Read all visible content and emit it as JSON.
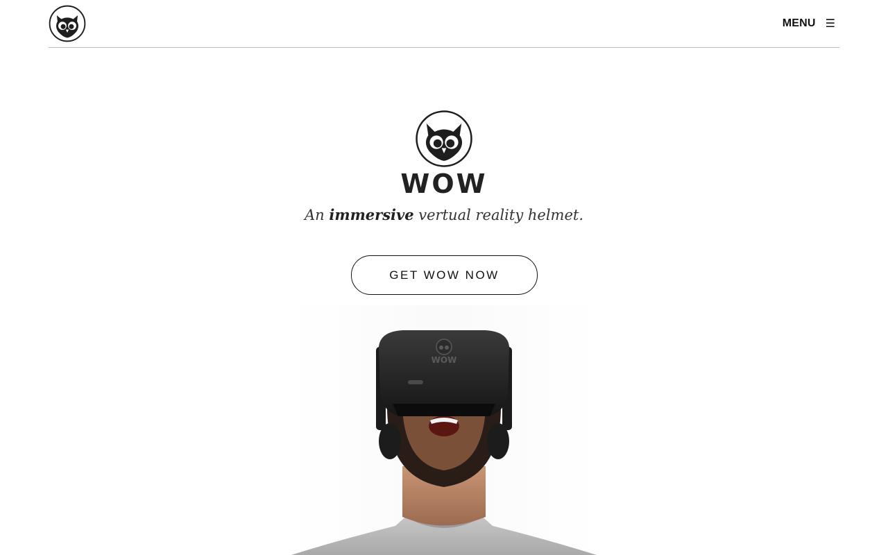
{
  "header": {
    "logo_icon": "owl-logo-icon",
    "menu_label": "MENU",
    "menu_icon": "hamburger-menu-icon",
    "menu_glyph": "☰"
  },
  "hero": {
    "logo_icon": "owl-logo-icon",
    "brand": "WOW",
    "tagline_prefix": "An ",
    "tagline_emphasis": "immersive",
    "tagline_suffix": " vertual reality helmet.",
    "cta_label": "GET WOW NOW",
    "image_subject": "person-wearing-vr-headset",
    "headset_brand": "WOW"
  },
  "colors": {
    "text": "#111111",
    "divider": "#bdbdbd",
    "background": "#ffffff"
  }
}
